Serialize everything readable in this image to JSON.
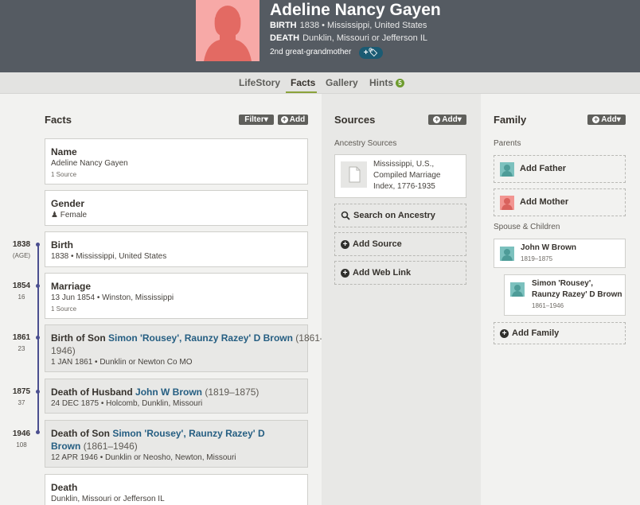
{
  "person": {
    "name": "Adeline Nancy Gayen",
    "birth_label": "BIRTH",
    "birth_value": "1838 • Mississippi, United States",
    "death_label": "DEATH",
    "death_value": "Dunklin, Missouri or Jefferson IL",
    "relationship": "2nd great-grandmother",
    "tag_button": "+🏷"
  },
  "tabs": [
    {
      "label": "LifeStory"
    },
    {
      "label": "Facts"
    },
    {
      "label": "Gallery"
    },
    {
      "label": "Hints",
      "badge": "5"
    }
  ],
  "facts": {
    "title": "Facts",
    "filter_label": "Filter▾",
    "add_label": "Add",
    "items": [
      {
        "title": "Name",
        "sub": "Adeline Nancy Gayen",
        "note": "1 Source"
      },
      {
        "title": "Gender",
        "sub": "Female",
        "icon": "person-icon"
      },
      {
        "year": "1838",
        "age": "(AGE)",
        "title": "Birth",
        "sub": "1838 • Mississippi, United States"
      },
      {
        "year": "1854",
        "age": "16",
        "title": "Marriage",
        "sub": "13 Jun 1854 • Winston, Mississippi",
        "note": "1 Source"
      },
      {
        "year": "1861",
        "age": "23",
        "title_prefix": "Birth of Son",
        "title_link": "Simon 'Rousey', Raunzy Razey' D Brown",
        "title_dates": "(1861–",
        "title_dates2": "1946)",
        "sub": "1 JAN 1861 • Dunklin or Newton Co MO"
      },
      {
        "year": "1875",
        "age": "37",
        "title_prefix": "Death of Husband",
        "title_link": "John W Brown",
        "title_dates": "(1819–1875)",
        "sub": "24 DEC 1875 • Holcomb, Dunklin, Missouri"
      },
      {
        "year": "1946",
        "age": "108",
        "title_prefix": "Death of Son",
        "title_link": "Simon 'Rousey', Raunzy Razey' D",
        "title_link2": "Brown",
        "title_dates": "(1861–1946)",
        "sub": "12 APR 1946 • Dunklin or Neosho, Newton, Missouri"
      },
      {
        "title": "Death",
        "sub": "Dunklin, Missouri or Jefferson IL"
      }
    ]
  },
  "sources": {
    "title": "Sources",
    "add_label": "Add▾",
    "section_label": "Ancestry Sources",
    "source_card": [
      "Mississippi, U.S.,",
      "Compiled Marriage",
      "Index, 1776-1935"
    ],
    "search_label": "Search on Ancestry",
    "add_source_label": "Add Source",
    "add_web_link_label": "Add Web Link"
  },
  "family": {
    "title": "Family",
    "add_label": "Add▾",
    "parents_label": "Parents",
    "add_father": "Add Father",
    "add_mother": "Add Mother",
    "spouse_label": "Spouse & Children",
    "spouse_name": "John W Brown",
    "spouse_dates": "1819–1875",
    "child_name_1": "Simon 'Rousey',",
    "child_name_2": "Raunzy Razey' D Brown",
    "child_dates": "1861–1946",
    "add_family": "Add Family"
  },
  "colors": {
    "header_bg": "#555b62",
    "link": "#255e82",
    "timeline": "#4b4f8f",
    "female_avatar": "#f7a9a7",
    "male_avatar": "#7cc1be",
    "active_tab_underline": "#8ba33b"
  }
}
